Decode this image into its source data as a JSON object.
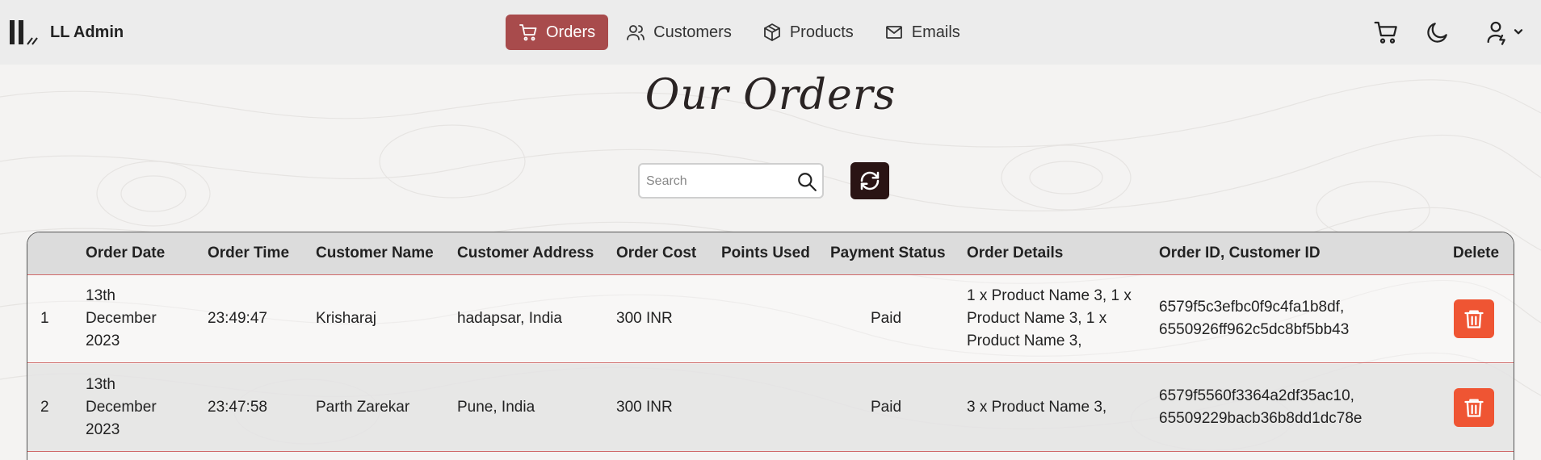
{
  "brand": {
    "name": "LL Admin"
  },
  "nav": {
    "items": [
      {
        "label": "Orders",
        "active": true,
        "icon": "cart-icon"
      },
      {
        "label": "Customers",
        "active": false,
        "icon": "users-icon"
      },
      {
        "label": "Products",
        "active": false,
        "icon": "box-icon"
      },
      {
        "label": "Emails",
        "active": false,
        "icon": "mail-icon"
      }
    ],
    "right_icons": [
      "cart-icon",
      "moon-icon",
      "user-menu-icon"
    ]
  },
  "page": {
    "title": "Our Orders"
  },
  "search": {
    "placeholder": "Search",
    "value": ""
  },
  "table": {
    "headers": [
      "Order Date",
      "Order Time",
      "Customer Name",
      "Customer Address",
      "Order Cost",
      "Points Used",
      "Payment Status",
      "Order Details",
      "Order ID, Customer ID",
      "Delete"
    ],
    "rows": [
      {
        "index": "1",
        "date_line1": "13th",
        "date_line2": "December",
        "date_line3": "2023",
        "time": "23:49:47",
        "customer_name": "Krisharaj",
        "address": "hadapsar, India",
        "cost": "300 INR",
        "points": "",
        "payment_status": "Paid",
        "details_line1": "1 x Product Name 3, 1 x",
        "details_line2": "Product Name 3, 1 x",
        "details_line3": "Product Name 3,",
        "order_id": "6579f5c3efbc0f9c4fa1b8df,",
        "customer_id": "6550926ff962c5dc8bf5bb43"
      },
      {
        "index": "2",
        "date_line1": "13th",
        "date_line2": "December",
        "date_line3": "2023",
        "time": "23:47:58",
        "customer_name": "Parth Zarekar",
        "address": "Pune, India",
        "cost": "300 INR",
        "points": "",
        "payment_status": "Paid",
        "details_line1": "3 x Product Name 3,",
        "details_line2": "",
        "details_line3": "",
        "order_id": "6579f5560f3364a2df35ac10,",
        "customer_id": "65509229bacb36b8dd1dc78e"
      }
    ]
  },
  "colors": {
    "accent": "#a84b4c",
    "delete": "#ef5533",
    "refresh": "#2a1414",
    "row_border": "#d06a6a"
  }
}
